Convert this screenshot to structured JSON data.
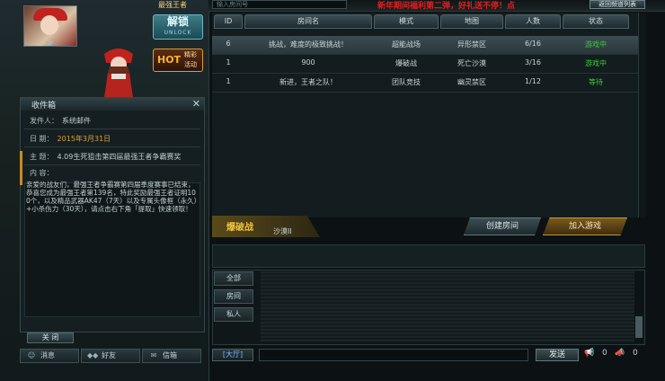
{
  "left": {
    "char_title": "最强王者",
    "unlock": {
      "label": "解锁",
      "sub": "UNLOCK"
    },
    "hot": {
      "label": "HOT",
      "sub": "精彩活动"
    }
  },
  "mail": {
    "title": "收件箱",
    "sender_label": "发件人：",
    "sender": "系统邮件",
    "date_label": "日 期：",
    "date": "2015年3月31日",
    "subject_label": "主 题：",
    "subject": "4.09生死狙击第四届最强王者争霸赛奖",
    "content_label": "内 容：",
    "body": "亲爱的战友们，最强王者争霸赛第四届季度赛事已结束，恭喜您成为最强王者第139名，特此奖励最强王者证明100个，以及精品武器AK47（7天）以及专属头像框（永久）+小杀伤力（30天），请点击右下角「提取」快速领取！",
    "close_label": "关 闭"
  },
  "bottom_left": [
    "消息",
    "好友",
    "信箱"
  ],
  "topbar": {
    "search_placeholder": "输入房间号",
    "marquee": "新年期间福利第二弹，好礼送不停！点",
    "back_label": "返回频道列表"
  },
  "table": {
    "headers": [
      "ID",
      "房间名",
      "模式",
      "地图",
      "人数",
      "状态"
    ],
    "rows": [
      {
        "id": "6",
        "name": "挑战，难度的极致挑战！",
        "mode": "超能战场",
        "map": "异形禁区",
        "count": "6/16",
        "status": "游戏中",
        "selected": true
      },
      {
        "id": "1",
        "name": "900",
        "mode": "爆破战",
        "map": "死亡沙漠",
        "count": "3/16",
        "status": "游戏中",
        "selected": false
      },
      {
        "id": "1",
        "name": "新进，王者之队！",
        "mode": "团队竞技",
        "map": "幽灵禁区",
        "count": "1/12",
        "status": "等待",
        "selected": false
      }
    ]
  },
  "mode": {
    "name": "爆破战",
    "map": "沙漠II"
  },
  "buttons": {
    "create": "创建房间",
    "join": "加入游戏"
  },
  "chat": {
    "tabs": [
      "全部",
      "房间",
      "私人"
    ],
    "channel": "[大厅]",
    "send": "发送",
    "count1": "0",
    "count2": "0"
  }
}
